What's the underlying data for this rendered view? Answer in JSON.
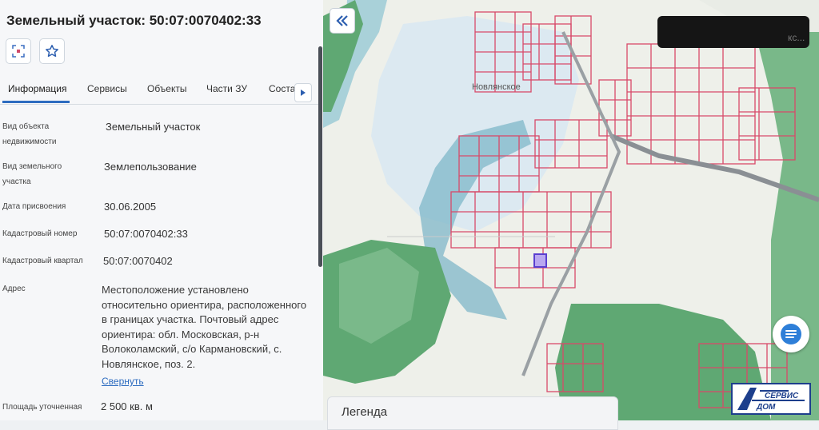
{
  "panel": {
    "title": "Земельный участок: 50:07:0070402:33",
    "tabs": [
      "Информация",
      "Сервисы",
      "Объекты",
      "Части ЗУ",
      "Соста"
    ],
    "fields": [
      {
        "label": "Вид объекта недвижимости",
        "value": "Земельный участок"
      },
      {
        "label": "Вид земельного участка",
        "value": "Землепользование"
      },
      {
        "label": "Дата присвоения",
        "value": "30.06.2005"
      },
      {
        "label": "Кадастровый номер",
        "value": "50:07:0070402:33"
      },
      {
        "label": "Кадастровый квартал",
        "value": "50:07:0070402"
      },
      {
        "label": "Адрес",
        "value": "Местоположение установлено относительно ориентира, расположенного в границах участка. Почтовый адрес ориентира: обл. Московская, р-н Волоколамский, с/о Кармановский, с. Новлянское, поз. 2."
      },
      {
        "label": "Площадь уточненная",
        "value": "2 500 кв. м"
      }
    ],
    "collapse_link": "Свернуть"
  },
  "map": {
    "village_label": "Новлянское",
    "legend_label": "Легенда",
    "search_partial": "кс...",
    "colors": {
      "parcel_line": "#d84a6a",
      "forest": "#5fa873",
      "water": "#7fb7c8",
      "selected": "#5a3fd0"
    }
  },
  "icons": {
    "locate": "locate-parcel-icon",
    "favorite": "star-icon",
    "back": "double-chevron-left-icon",
    "next": "triangle-right-icon",
    "chat": "chat-icon"
  },
  "logo_text": "СЕРВИС ДОМ"
}
